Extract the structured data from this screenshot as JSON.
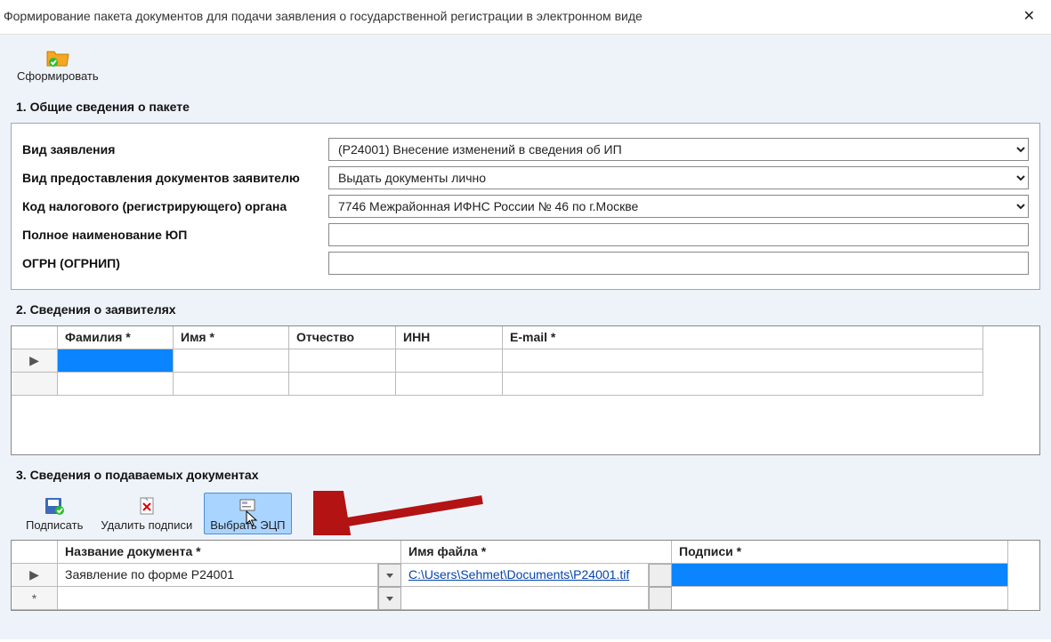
{
  "window": {
    "title": "Формирование пакета документов для подачи заявления о государственной регистрации в электронном виде"
  },
  "toolbar": {
    "form_label": "Сформировать"
  },
  "section1": {
    "title": "1. Общие сведения о пакете",
    "rows": {
      "application_type": {
        "label": "Вид заявления",
        "value": "(Р24001) Внесение изменений в сведения об ИП"
      },
      "delivery": {
        "label": "Вид предоставления документов заявителю",
        "value": "Выдать документы лично"
      },
      "tax_code": {
        "label": "Код налогового (регистрирующего) органа",
        "value": "7746 Межрайонная ИФНС России № 46 по г.Москве"
      },
      "full_name": {
        "label": "Полное наименование ЮП",
        "value": ""
      },
      "ogrn": {
        "label": "ОГРН (ОГРНИП)",
        "value": ""
      }
    }
  },
  "section2": {
    "title": "2. Сведения о заявителях",
    "columns": {
      "c1": "Фамилия *",
      "c2": "Имя *",
      "c3": "Отчество",
      "c4": "ИНН",
      "c5": "E-mail *"
    },
    "row1": {
      "handle": "▶",
      "c1": "",
      "c2": "",
      "c3": "",
      "c4": "",
      "c5": ""
    }
  },
  "section3": {
    "title": "3. Сведения о подаваемых документах",
    "buttons": {
      "sign": "Подписать",
      "delete": "Удалить подписи",
      "choose": "Выбрать ЭЦП"
    },
    "columns": {
      "c1": "Название документа *",
      "c2": "Имя файла *",
      "c3": "Подписи *"
    },
    "row1": {
      "handle": "▶",
      "name": "Заявление по форме Р24001",
      "file": "C:\\Users\\Sehmet\\Documents\\P24001.tif"
    },
    "row2": {
      "handle": "*",
      "name": "",
      "file": ""
    }
  }
}
